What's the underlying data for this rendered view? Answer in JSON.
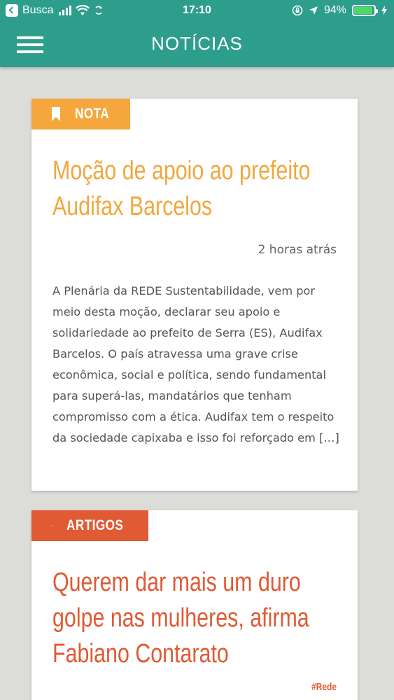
{
  "status_bar": {
    "back_app": "Busca",
    "time": "17:10",
    "battery_percent": "94%",
    "battery_level": 0.94,
    "battery_color": "#4cd964"
  },
  "header": {
    "title": "NOTÍCIAS",
    "menu_icon": "hamburger-menu-icon",
    "color": "#2e9e8c"
  },
  "posts": [
    {
      "category": "NOTA",
      "category_icon": "bookmark-icon",
      "category_color": "#f5a73d",
      "title": "Moção de apoio ao prefeito Audifax Barcelos",
      "time": "2 horas atrás",
      "excerpt": "A Plenária da REDE Sustentabilidade, vem por meio desta moção, declarar seu apoio e solidariedade ao prefeito de Serra (ES), Audifax Barcelos. O país atravessa uma grave crise econômica, social e política, sendo fundamental para superá-las, mandatários que tenham compromisso com a ética. Audifax tem o respeito da sociedade capixaba e isso foi reforçado em […]"
    },
    {
      "category": "ARTIGOS",
      "category_icon": "article-s-icon",
      "category_color": "#e05a33",
      "title": "Querem dar mais um duro golpe nas mulheres, afirma Fabiano Contarato",
      "hashtag": "#Rede"
    }
  ]
}
